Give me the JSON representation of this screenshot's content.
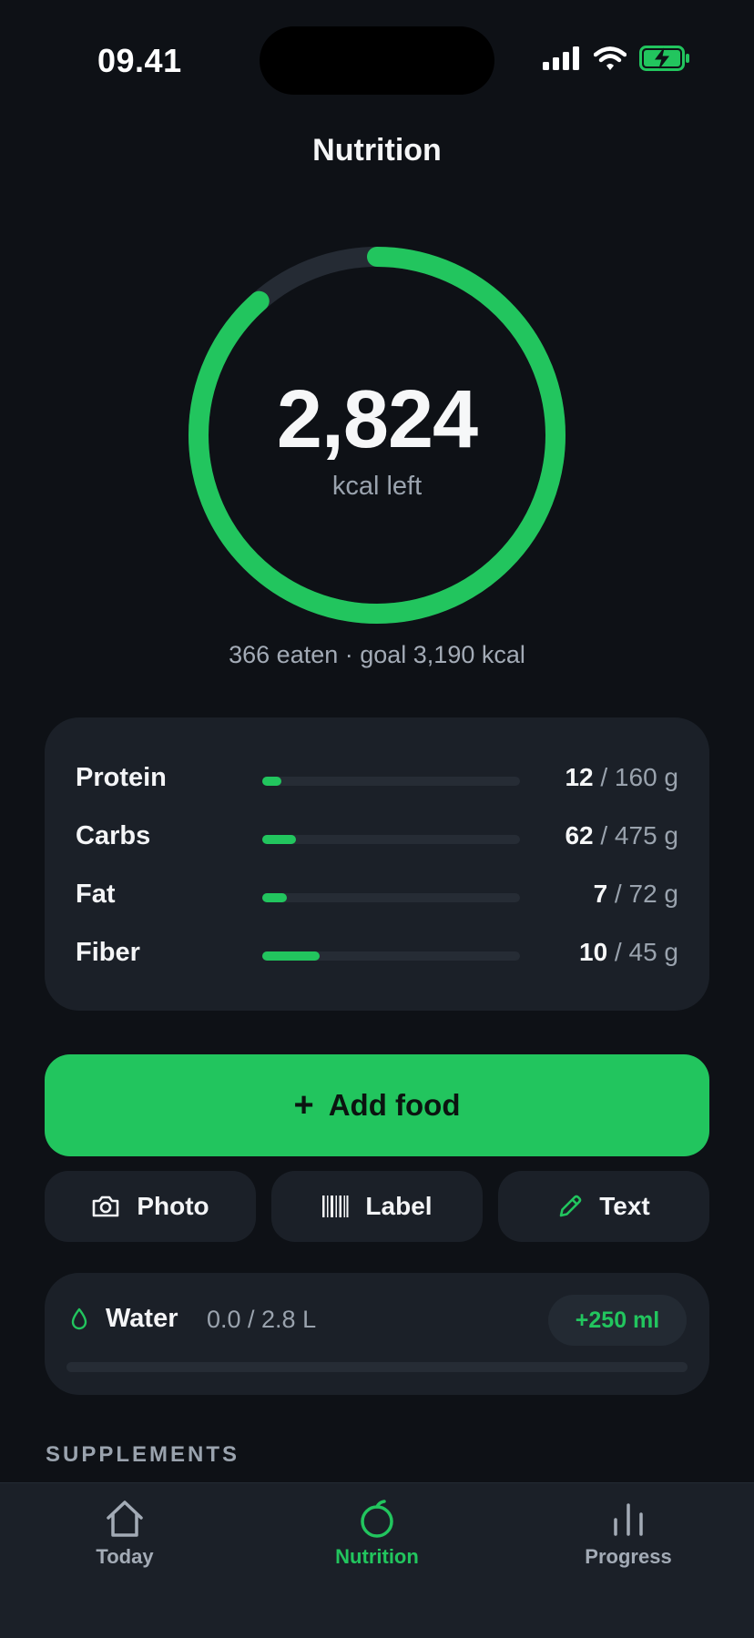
{
  "status_bar": {
    "time": "09.41"
  },
  "header": {
    "title": "Nutrition"
  },
  "calories": {
    "left_value": "2,824",
    "left_label": "kcal left",
    "summary": "366 eaten · goal 3,190 kcal",
    "progress_fraction": 0.885
  },
  "macros": [
    {
      "name": "Protein",
      "current": "12",
      "goal": " / 160 g",
      "fraction": 0.075
    },
    {
      "name": "Carbs",
      "current": "62",
      "goal": " / 475 g",
      "fraction": 0.13
    },
    {
      "name": "Fat",
      "current": "7",
      "goal": " / 72 g",
      "fraction": 0.097
    },
    {
      "name": "Fiber",
      "current": "10",
      "goal": " / 45 g",
      "fraction": 0.222
    }
  ],
  "actions": {
    "add_food_plus": "+",
    "add_food_label": "Add food",
    "photo_label": "Photo",
    "label_label": "Label",
    "text_label": "Text"
  },
  "water": {
    "title": "Water",
    "amount": "0.0 / 2.8 L",
    "add_button": "+250 ml",
    "fraction": 0.0
  },
  "sections": {
    "supplements": "SUPPLEMENTS"
  },
  "tabs": [
    {
      "label": "Today",
      "icon": "home-icon",
      "active": false
    },
    {
      "label": "Nutrition",
      "icon": "apple-icon",
      "active": true
    },
    {
      "label": "Progress",
      "icon": "bar-chart-icon",
      "active": false
    }
  ],
  "colors": {
    "accent": "#22c55e",
    "background": "#0e1116",
    "card": "#1b2028"
  }
}
